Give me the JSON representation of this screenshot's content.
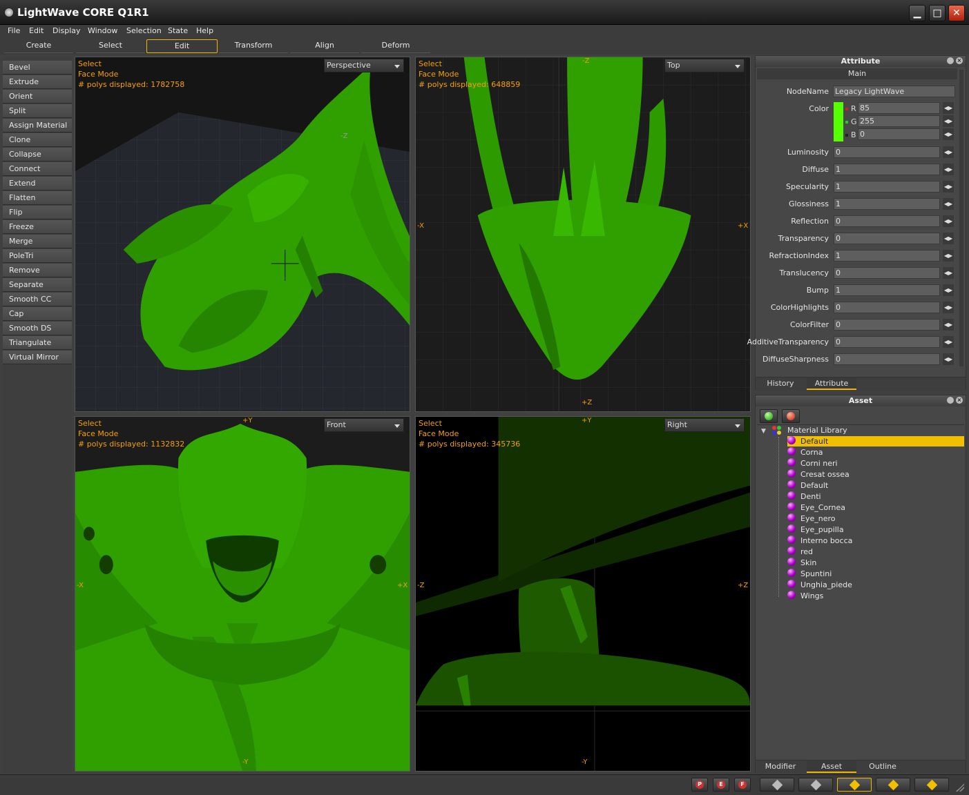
{
  "window": {
    "title": "LightWave CORE Q1R1",
    "minimize": "▁",
    "maximize": "□",
    "close": "✕"
  },
  "menu": [
    "File",
    "Edit",
    "Display",
    "Window",
    "Selection",
    "State",
    "Help"
  ],
  "main_tabs": [
    {
      "label": "Create",
      "active": false
    },
    {
      "label": "Select",
      "active": false
    },
    {
      "label": "Edit",
      "active": true
    },
    {
      "label": "Transform",
      "active": false
    },
    {
      "label": "Align",
      "active": false
    },
    {
      "label": "Deform",
      "active": false
    }
  ],
  "tools": [
    "Bevel",
    "Extrude",
    "Orient",
    "Split",
    "Assign Material",
    "Clone",
    "Collapse",
    "Connect",
    "Extend",
    "Flatten",
    "Flip",
    "Freeze",
    "Merge",
    "PoleTri",
    "Remove",
    "Separate",
    "Smooth CC",
    "Cap",
    "Smooth DS",
    "Triangulate",
    "Virtual Mirror"
  ],
  "viewports": [
    {
      "mode": "Select",
      "submode": "Face Mode",
      "polys": "# polys displayed: 1782758",
      "view": "Perspective",
      "axes": {
        "top": "",
        "bottom": "",
        "left": "",
        "right": "",
        "persp": "-Z"
      }
    },
    {
      "mode": "Select",
      "submode": "Face Mode",
      "polys": "# polys displayed: 648859",
      "view": "Top",
      "axes": {
        "top": "-Z",
        "bottom": "+Z",
        "left": "-X",
        "right": "+X"
      }
    },
    {
      "mode": "Select",
      "submode": "Face Mode",
      "polys": "# polys displayed: 1132832",
      "view": "Front",
      "axes": {
        "top": "+Y",
        "bottom": "-Y",
        "left": "-X",
        "right": "+X"
      }
    },
    {
      "mode": "Select",
      "submode": "Face Mode",
      "polys": "# polys displayed: 345736",
      "view": "Right",
      "axes": {
        "top": "+Y",
        "bottom": "-Y",
        "left": "-Z",
        "right": "+Z"
      }
    }
  ],
  "attribute_panel": {
    "title": "Attribute",
    "section": "Main",
    "nodename_label": "NodeName",
    "nodename": "Legacy LightWave",
    "color_label": "Color",
    "color_swatch": "#55ff00",
    "rgb": [
      {
        "ch": "R",
        "val": "85",
        "dot": "#cc2222"
      },
      {
        "ch": "G",
        "val": "255",
        "dot": "#22cc22"
      },
      {
        "ch": "B",
        "val": "0",
        "dot": "#222222"
      }
    ],
    "fields": [
      {
        "label": "Luminosity",
        "value": "0"
      },
      {
        "label": "Diffuse",
        "value": "1"
      },
      {
        "label": "Specularity",
        "value": "1"
      },
      {
        "label": "Glossiness",
        "value": "1"
      },
      {
        "label": "Reflection",
        "value": "0"
      },
      {
        "label": "Transparency",
        "value": "0"
      },
      {
        "label": "RefractionIndex",
        "value": "1"
      },
      {
        "label": "Translucency",
        "value": "0"
      },
      {
        "label": "Bump",
        "value": "1"
      },
      {
        "label": "ColorHighlights",
        "value": "0"
      },
      {
        "label": "ColorFilter",
        "value": "0"
      },
      {
        "label": "AdditiveTransparency",
        "value": "0"
      },
      {
        "label": "DiffuseSharpness",
        "value": "0"
      }
    ],
    "tabs": [
      {
        "label": "History",
        "active": false
      },
      {
        "label": "Attribute",
        "active": true
      }
    ]
  },
  "asset_panel": {
    "title": "Asset",
    "library_label": "Material Library",
    "materials": [
      "Default",
      "Corna",
      "Corni neri",
      "Cresat ossea",
      "Default",
      "Denti",
      "Eye_Cornea",
      "Eye_nero",
      "Eye_pupilla",
      "Interno bocca",
      "red",
      "Skin",
      "Spuntini",
      "Unghia_piede",
      "Wings"
    ],
    "selected_index": 0,
    "tabs": [
      {
        "label": "Modifier Stack",
        "active": false
      },
      {
        "label": "Asset",
        "active": true
      },
      {
        "label": "Outline",
        "active": false
      }
    ]
  },
  "status_buttons": [
    "P",
    "E",
    "F"
  ],
  "colors": {
    "accent": "#f0b800",
    "info": "#f5a000",
    "model": "#2fa000"
  }
}
